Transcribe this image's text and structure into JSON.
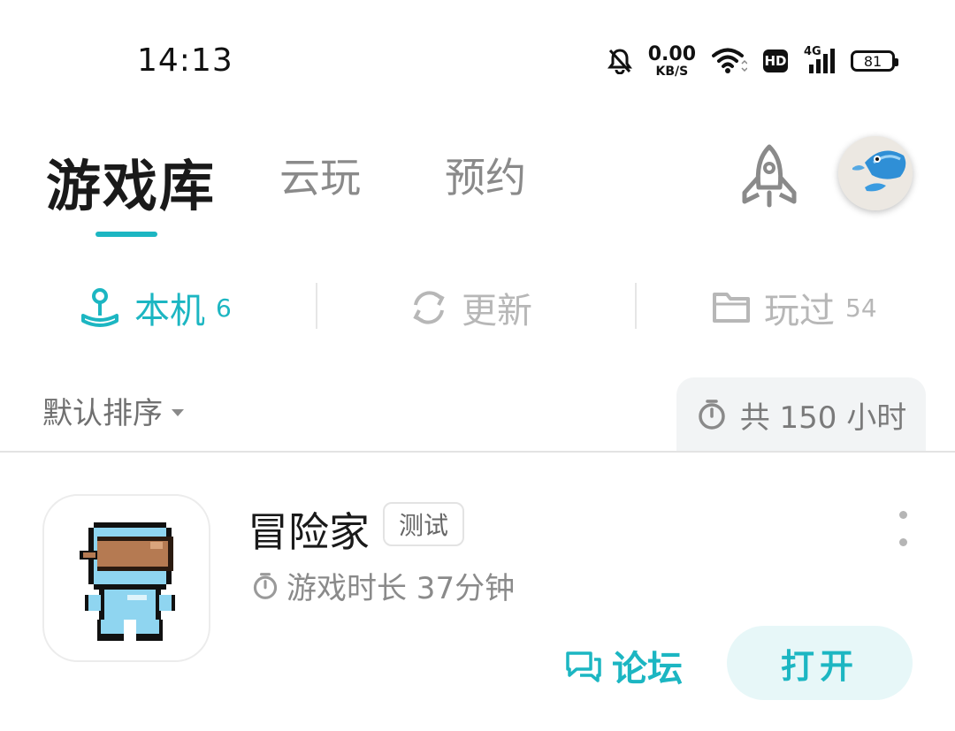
{
  "status_bar": {
    "time": "14:13",
    "net_speed_value": "0.00",
    "net_speed_unit": "KB/S",
    "hd_label": "HD",
    "network_label": "4G",
    "battery": "81",
    "icons": [
      "bell-muted-icon",
      "wifi-icon",
      "signal-icon",
      "battery-icon"
    ]
  },
  "top_tabs": [
    {
      "label": "游戏库",
      "active": true
    },
    {
      "label": "云玩",
      "active": false
    },
    {
      "label": "预约",
      "active": false
    }
  ],
  "sub_tabs": [
    {
      "label": "本机",
      "count": "6",
      "icon": "joystick-icon",
      "active": true
    },
    {
      "label": "更新",
      "count": "",
      "icon": "refresh-icon",
      "active": false
    },
    {
      "label": "玩过",
      "count": "54",
      "icon": "folder-icon",
      "active": false
    }
  ],
  "sort": {
    "label": "默认排序"
  },
  "total_time": {
    "label": "共 150 小时"
  },
  "games": [
    {
      "name": "冒险家",
      "tag": "测试",
      "playtime": "游戏时长 37分钟",
      "forum_label": "论坛",
      "open_label": "打开"
    }
  ],
  "colors": {
    "accent": "#1cb6c2",
    "accent_bg": "#e7f7f8",
    "muted": "#b7b7b7"
  }
}
